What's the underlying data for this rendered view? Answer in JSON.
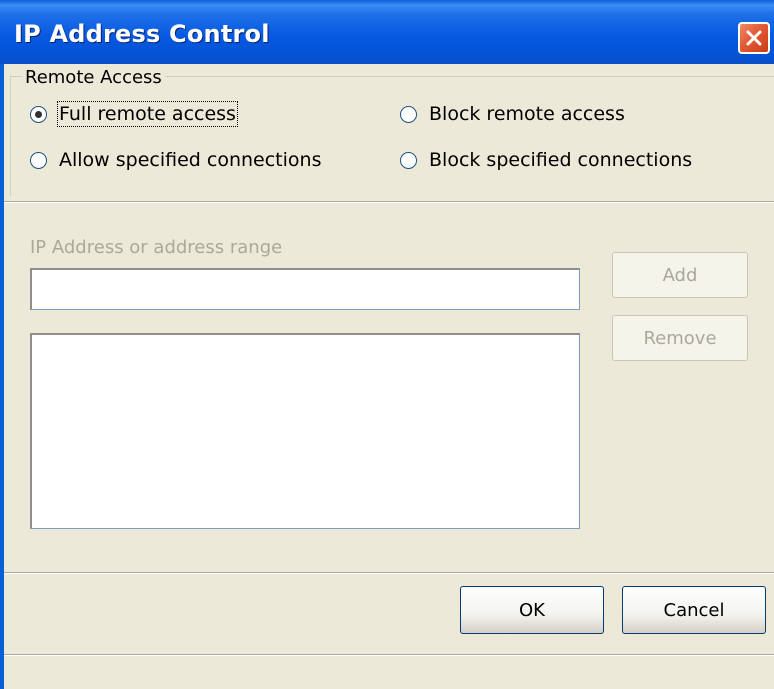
{
  "window": {
    "title": "IP Address Control"
  },
  "remote_access": {
    "group_label": "Remote Access",
    "options": [
      {
        "label": "Full remote access",
        "selected": true
      },
      {
        "label": "Block remote access",
        "selected": false
      },
      {
        "label": "Allow specified connections",
        "selected": false
      },
      {
        "label": "Block specified connections",
        "selected": false
      }
    ]
  },
  "ip_section": {
    "label": "IP Address or address range",
    "input_value": "",
    "list_items": [],
    "add_label": "Add",
    "remove_label": "Remove"
  },
  "footer": {
    "ok_label": "OK",
    "cancel_label": "Cancel"
  },
  "colors": {
    "title_bar": "#0558e0",
    "close_button": "#e35a33",
    "dialog_bg": "#ece9d8",
    "disabled_text": "#aca899"
  }
}
